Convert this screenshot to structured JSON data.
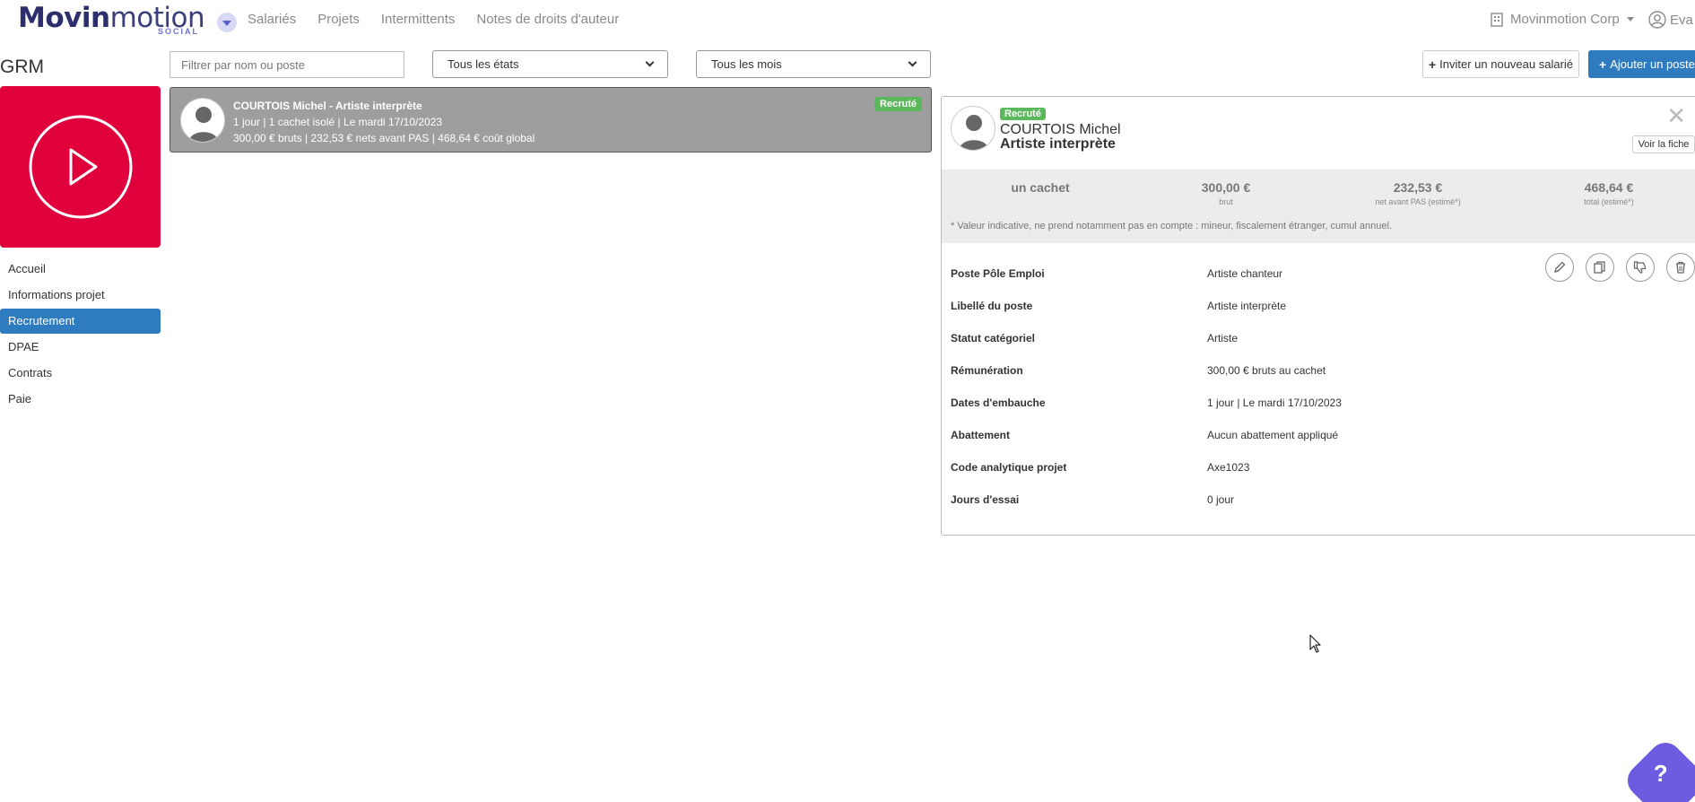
{
  "brand": {
    "name_bold": "Movin",
    "name_light": "motion",
    "sub": "SOCIAL",
    "accent": "#6d5ce0"
  },
  "nav": {
    "links": [
      "Salariés",
      "Projets",
      "Intermittents",
      "Notes de droits d'auteur"
    ],
    "company": "Movinmotion Corp",
    "user": "Eva",
    "toggle_icon": "chevron-down-icon"
  },
  "sidebar": {
    "project_title": "GRM",
    "project_card_color": "#e0003c",
    "items": [
      {
        "label": "Accueil",
        "active": false
      },
      {
        "label": "Informations projet",
        "active": false
      },
      {
        "label": "Recrutement",
        "active": true
      },
      {
        "label": "DPAE",
        "active": false
      },
      {
        "label": "Contrats",
        "active": false
      },
      {
        "label": "Paie",
        "active": false
      }
    ]
  },
  "filters": {
    "search_placeholder": "Filtrer par nom ou poste",
    "state_select": "Tous les états",
    "month_select": "Tous les mois"
  },
  "actions": {
    "invite_label": "Inviter un nouveau salarié",
    "add_label": "Ajouter un poste"
  },
  "recruit_row": {
    "title": "COURTOIS Michel - Artiste interprète",
    "line2": "1 jour | 1 cachet isolé | Le mardi 17/10/2023",
    "line3": "300,00 € bruts | 232,53 € nets avant PAS | 468,64 € coût global",
    "badge": "Recruté"
  },
  "detail": {
    "badge": "Recruté",
    "name": "COURTOIS Michel",
    "role": "Artiste interprète",
    "view_button": "Voir la fiche",
    "close": "✕",
    "summary": {
      "cachet": "un cachet",
      "brut_value": "300,00 €",
      "brut_label": "brut",
      "net_value": "232,53 €",
      "net_label": "net avant PAS (estimé*)",
      "total_value": "468,64 €",
      "total_label": "total (estimé*)",
      "note": "* Valeur indicative, ne prend notamment pas en compte : mineur, fiscalement étranger, cumul annuel."
    },
    "rows": [
      {
        "k": "Poste Pôle Emploi",
        "v": "Artiste chanteur"
      },
      {
        "k": "Libellé du poste",
        "v": "Artiste interprète"
      },
      {
        "k": "Statut catégoriel",
        "v": "Artiste"
      },
      {
        "k": "Rémunération",
        "v": "300,00 € bruts au cachet"
      },
      {
        "k": "Dates d'embauche",
        "v": "1 jour | Le mardi 17/10/2023"
      },
      {
        "k": "Abattement",
        "v": "Aucun abattement appliqué"
      },
      {
        "k": "Code analytique projet",
        "v": "Axe1023"
      },
      {
        "k": "Jours d'essai",
        "v": "0 jour"
      }
    ],
    "action_icons": [
      "edit-icon",
      "copy-icon",
      "thumbs-down-icon",
      "trash-icon"
    ]
  },
  "help": {
    "label": "?"
  }
}
